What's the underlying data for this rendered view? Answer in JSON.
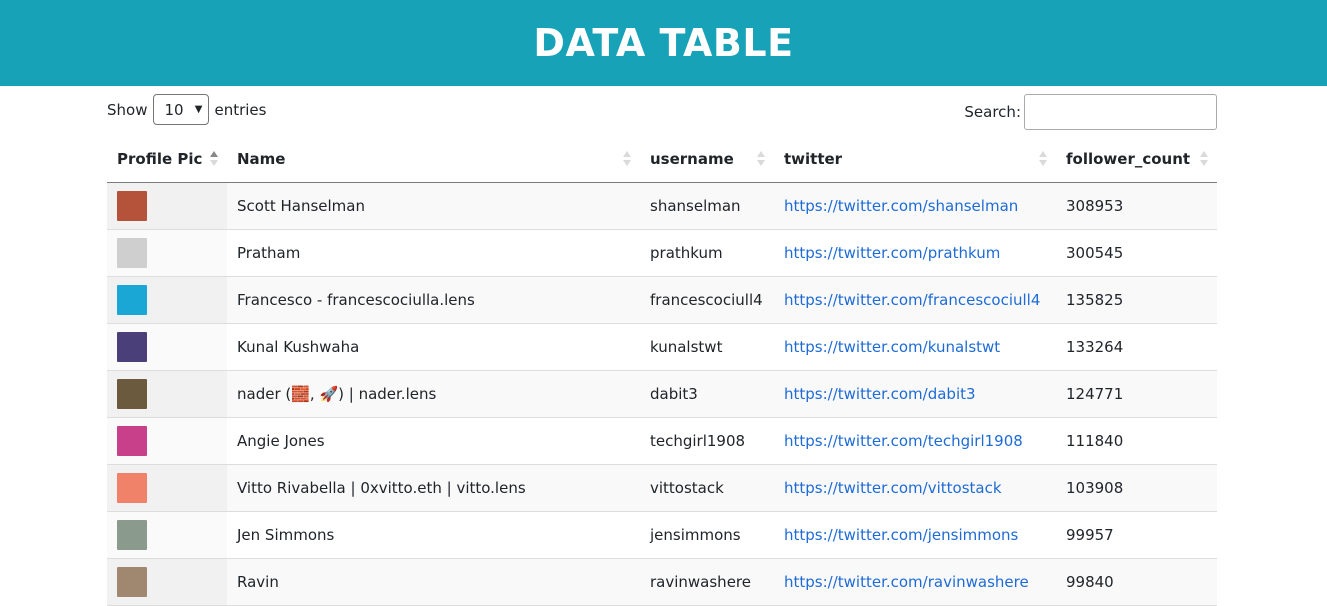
{
  "header": {
    "title": "DATA TABLE"
  },
  "controls": {
    "show_label": "Show",
    "page_size": "10",
    "entries_label": "entries",
    "search_label": "Search:",
    "search_value": ""
  },
  "columns": [
    {
      "label": "Profile Pic",
      "sort": "asc"
    },
    {
      "label": "Name",
      "sort": "none"
    },
    {
      "label": "username",
      "sort": "none"
    },
    {
      "label": "twitter",
      "sort": "none"
    },
    {
      "label": "follower_count",
      "sort": "none"
    }
  ],
  "rows": [
    {
      "name": "Scott Hanselman",
      "username": "shanselman",
      "twitter": "https://twitter.com/shanselman",
      "follower_count": "308953",
      "avatar_color": "#b5533a"
    },
    {
      "name": "Pratham",
      "username": "prathkum",
      "twitter": "https://twitter.com/prathkum",
      "follower_count": "300545",
      "avatar_color": "#cfcfcf"
    },
    {
      "name": "Francesco - francescociulla.lens",
      "username": "francescociull4",
      "twitter": "https://twitter.com/francescociull4",
      "follower_count": "135825",
      "avatar_color": "#1aa7d6"
    },
    {
      "name": "Kunal Kushwaha",
      "username": "kunalstwt",
      "twitter": "https://twitter.com/kunalstwt",
      "follower_count": "133264",
      "avatar_color": "#4b3f7a"
    },
    {
      "name": "nader (🧱, 🚀) | nader.lens",
      "username": "dabit3",
      "twitter": "https://twitter.com/dabit3",
      "follower_count": "124771",
      "avatar_color": "#6b5a3e"
    },
    {
      "name": "Angie Jones",
      "username": "techgirl1908",
      "twitter": "https://twitter.com/techgirl1908",
      "follower_count": "111840",
      "avatar_color": "#c9408a"
    },
    {
      "name": "Vitto Rivabella | 0xvitto.eth | vitto.lens",
      "username": "vittostack",
      "twitter": "https://twitter.com/vittostack",
      "follower_count": "103908",
      "avatar_color": "#f0826a"
    },
    {
      "name": "Jen Simmons",
      "username": "jensimmons",
      "twitter": "https://twitter.com/jensimmons",
      "follower_count": "99957",
      "avatar_color": "#8a9a8c"
    },
    {
      "name": "Ravin",
      "username": "ravinwashere",
      "twitter": "https://twitter.com/ravinwashere",
      "follower_count": "99840",
      "avatar_color": "#a08770"
    }
  ]
}
